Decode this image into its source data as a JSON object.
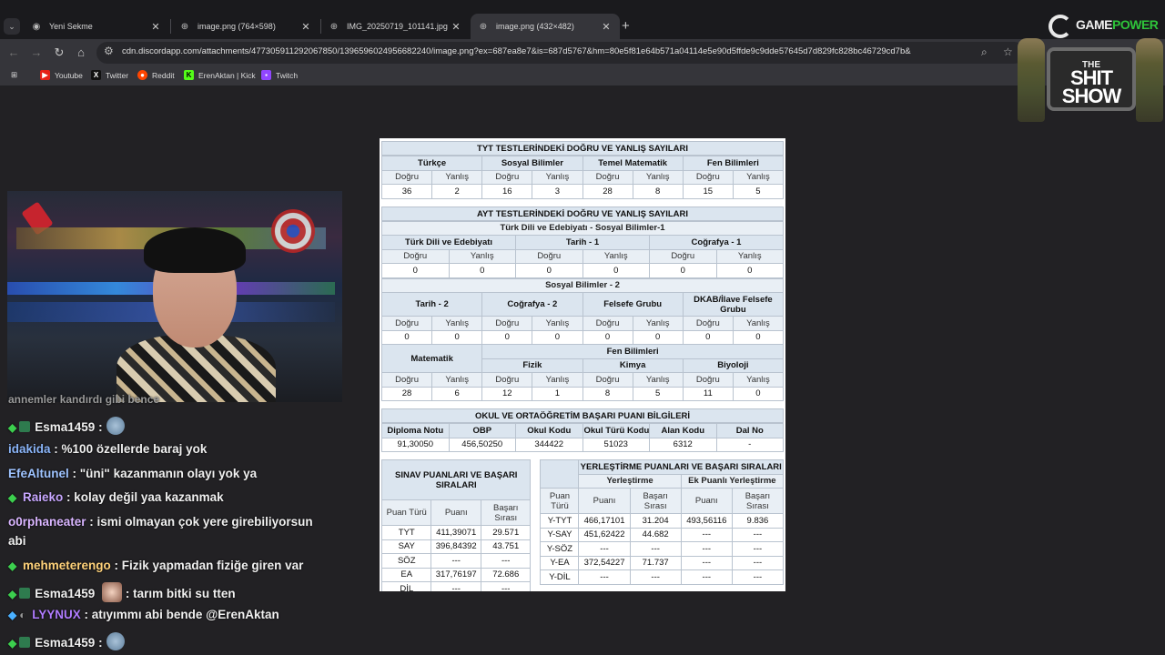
{
  "browser": {
    "tabs": [
      {
        "title": "Yeni Sekme",
        "active": false
      },
      {
        "title": "image.png (764×598)",
        "active": false
      },
      {
        "title": "IMG_20250719_101141.jpg (10",
        "active": false
      },
      {
        "title": "image.png (432×482)",
        "active": true
      }
    ],
    "url": "cdn.discordapp.com/attachments/477305911292067850/1396596024956682240/image.png?ex=687ea8e7&is=687d5767&hm=80e5f81e64b571a04114e5e90d5ffde9c9dde57645d7d829fc828bc46729cd7b&",
    "bookmarks": [
      {
        "label": "Youtube",
        "color": "#e62117"
      },
      {
        "label": "Twitter",
        "color": "#000000"
      },
      {
        "label": "Reddit",
        "color": "#ff4500"
      },
      {
        "label": "ErenAktan | Kick",
        "color": "#53fc18"
      },
      {
        "label": "Twitch",
        "color": "#9146ff"
      }
    ]
  },
  "overlay": {
    "gamepower_a": "GAME",
    "gamepower_b": "POWER",
    "show_the": "THE",
    "show_title": "SHIT SHOW"
  },
  "chat": [
    {
      "user": "",
      "text": "annemler kandırdı gibi bence",
      "color": "#f0f0f0",
      "partial": true
    },
    {
      "user": "Esma1459",
      "text": ":",
      "color": "#f0f0f0",
      "badge": "sub",
      "emote": "circle"
    },
    {
      "user": "idakida",
      "text": ": %100 özellerde baraj yok",
      "color": "#8ab4f8"
    },
    {
      "user": "EfeAltunel",
      "text": ": \"üni\" kazanmanın olayı yok ya",
      "color": "#9ec3ff"
    },
    {
      "user": "Raieko",
      "text": ": kolay değil yaa kazanmak",
      "color": "#c7a6ff",
      "badge": "sub"
    },
    {
      "user": "o0rphaneater",
      "text": ": ismi olmayan çok yere girebiliyorsun",
      "color": "#d9b5ff"
    },
    {
      "user": "",
      "text": "abi",
      "color": "#f0f0f0"
    },
    {
      "user": "mehmeterengo",
      "text": ": Fizik yapmadan fiziğe giren var",
      "color": "#ffd27a",
      "badge": "sub"
    },
    {
      "user": "Esma1459",
      "text": ": tarım bitki su tten",
      "color": "#f0f0f0",
      "badge": "sub",
      "emote": "face"
    },
    {
      "user": "LYYNUX",
      "text": ": atıyımmı abi bende @ErenAktan",
      "color": "#b07cff",
      "badge": "gem"
    },
    {
      "user": "Esma1459",
      "text": ":",
      "color": "#f0f0f0",
      "badge": "sub",
      "emote": "circle"
    }
  ],
  "document": {
    "tyt_title": "TYT TESTLERİNDEKİ DOĞRU VE YANLIŞ SAYILARI",
    "tyt_subjects": [
      "Türkçe",
      "Sosyal Bilimler",
      "Temel Matematik",
      "Fen Bilimleri"
    ],
    "d": "Doğru",
    "y": "Yanlış",
    "tyt_values": [
      "36",
      "2",
      "16",
      "3",
      "28",
      "8",
      "15",
      "5"
    ],
    "ayt_title": "AYT TESTLERİNDEKİ DOĞRU VE YANLIŞ SAYILARI",
    "ayt_sub1": "Türk Dili ve Edebiyatı - Sosyal Bilimler-1",
    "ayt_group1": [
      "Türk Dili ve Edebiyatı",
      "Tarih - 1",
      "Coğrafya - 1"
    ],
    "ayt_values1": [
      "0",
      "0",
      "0",
      "0",
      "0",
      "0"
    ],
    "ayt_sub2": "Sosyal Bilimler - 2",
    "ayt_group2": [
      "Tarih - 2",
      "Coğrafya - 2",
      "Felsefe Grubu",
      "DKAB/İlave Felsefe Grubu"
    ],
    "ayt_values2": [
      "0",
      "0",
      "0",
      "0",
      "0",
      "0",
      "0",
      "0"
    ],
    "mat_label": "Matematik",
    "fen_label": "Fen Bilimleri",
    "ayt_group3": [
      "Fizik",
      "Kimya",
      "Biyoloji"
    ],
    "ayt_values3": [
      "28",
      "6",
      "12",
      "1",
      "8",
      "5",
      "11",
      "0"
    ],
    "obp_title": "OKUL VE ORTAÖĞRETİM BAŞARI PUANI BİLGİLERİ",
    "obp_headers": [
      "Diploma Notu",
      "OBP",
      "Okul Kodu",
      "Okul Türü Kodu",
      "Alan Kodu",
      "Dal No"
    ],
    "obp_values": [
      "91,30050",
      "456,50250",
      "344422",
      "51023",
      "6312",
      "-"
    ],
    "sinav_title": "SINAV PUANLARI VE BAŞARI SIRALARI",
    "yer_title": "YERLEŞTİRME PUANLARI VE BAŞARI SIRALARI",
    "yer_sub": [
      "Yerleştirme",
      "Ek Puanlı Yerleştirme"
    ],
    "col_puan_turu": "Puan Türü",
    "col_puani": "Puanı",
    "col_basari": "Başarı Sırası",
    "sinav_rows": [
      [
        "TYT",
        "411,39071",
        "29.571"
      ],
      [
        "SAY",
        "396,84392",
        "43.751"
      ],
      [
        "SÖZ",
        "---",
        "---"
      ],
      [
        "EA",
        "317,76197",
        "72.686"
      ],
      [
        "DİL",
        "---",
        "---"
      ]
    ],
    "yer_rows": [
      [
        "Y-TYT",
        "466,17101",
        "31.204",
        "493,56116",
        "9.836"
      ],
      [
        "Y-SAY",
        "451,62422",
        "44.682",
        "---",
        "---"
      ],
      [
        "Y-SÖZ",
        "---",
        "---",
        "---",
        "---"
      ],
      [
        "Y-EA",
        "372,54227",
        "71.737",
        "---",
        "---"
      ],
      [
        "Y-DİL",
        "---",
        "---",
        "---",
        "---"
      ]
    ]
  }
}
